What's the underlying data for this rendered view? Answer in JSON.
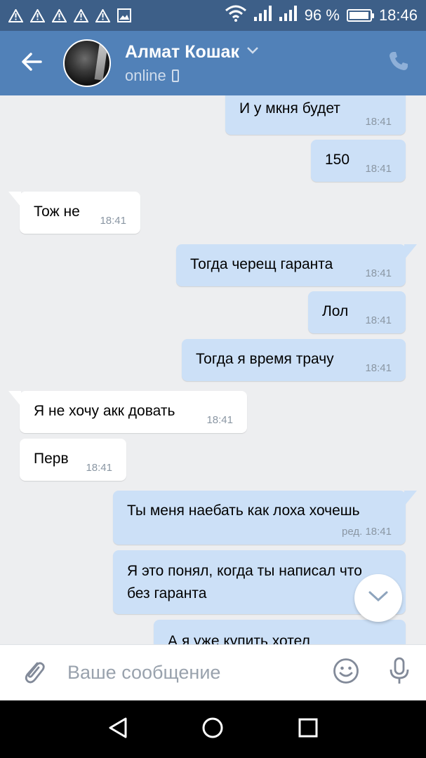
{
  "status_bar": {
    "battery_percent": "96 %",
    "battery_level": 0.96,
    "time": "18:46",
    "icons": [
      "warning-icon",
      "warning-icon",
      "warning-icon",
      "warning-icon",
      "warning-icon",
      "gallery-icon",
      "wifi-icon",
      "signal-icon",
      "signal-icon",
      "battery-icon"
    ]
  },
  "header": {
    "name": "Алмат Кошак",
    "status": "online",
    "colors": {
      "header_bg": "#5181b8",
      "status_bar_bg": "#3d5f88"
    }
  },
  "messages": [
    {
      "dir": "out",
      "text": "И у мкня будет",
      "time": "18:41"
    },
    {
      "dir": "out",
      "text": "150",
      "time": "18:41"
    },
    {
      "dir": "in",
      "text": "Тож не",
      "time": "18:41"
    },
    {
      "dir": "out",
      "text": "Тогда черещ гаранта",
      "time": "18:41"
    },
    {
      "dir": "out",
      "text": "Лол",
      "time": "18:41"
    },
    {
      "dir": "out",
      "text": "Тогда я время трачу",
      "time": "18:41"
    },
    {
      "dir": "in",
      "text": "Я не хочу акк довать",
      "time": "18:41"
    },
    {
      "dir": "in",
      "text": "Перв",
      "time": "18:41"
    },
    {
      "dir": "out",
      "text": "Ты меня наебать как лоха хочешь",
      "time": "ред. 18:41"
    },
    {
      "dir": "out",
      "line1": "Я это понял, когда ты написал что",
      "line2": "без гаранта"
    },
    {
      "dir": "out",
      "text": "А я уже купить хотел"
    }
  ],
  "composer": {
    "placeholder": "Ваше сообщение"
  },
  "colors": {
    "outgoing_bubble": "#cce0f7",
    "incoming_bubble": "#ffffff",
    "chat_bg": "#edeef0"
  }
}
